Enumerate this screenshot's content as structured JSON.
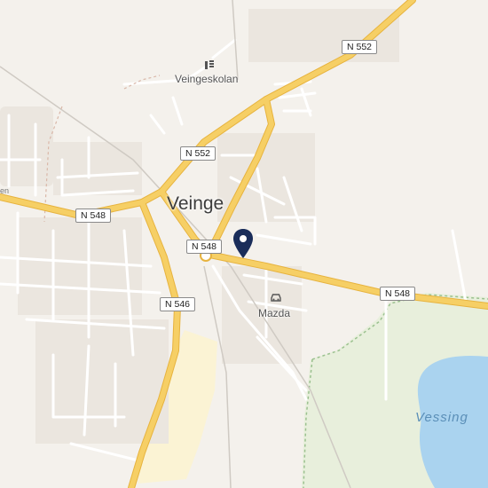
{
  "map": {
    "town_name": "Veinge",
    "road_shields": {
      "n552_north": "N 552",
      "n552_mid": "N 552",
      "n548_west": "N 548",
      "n548_center": "N 548",
      "n548_east": "N 548",
      "n546": "N 546"
    },
    "pois": {
      "school": "Veingeskolan",
      "car_dealer": "Mazda"
    },
    "lake_label": "Vessing",
    "edge_street_fragment": "en",
    "colors": {
      "land": "#f4f1ec",
      "major_road": "#f6cf65",
      "major_road_casing": "#e7b33e",
      "minor_road": "#ffffff",
      "water": "#aad3ef",
      "forest": "#e8efdc",
      "industrial": "#fbf3d4",
      "building": "#e9e3dc",
      "marker": "#1a2d5a"
    }
  }
}
